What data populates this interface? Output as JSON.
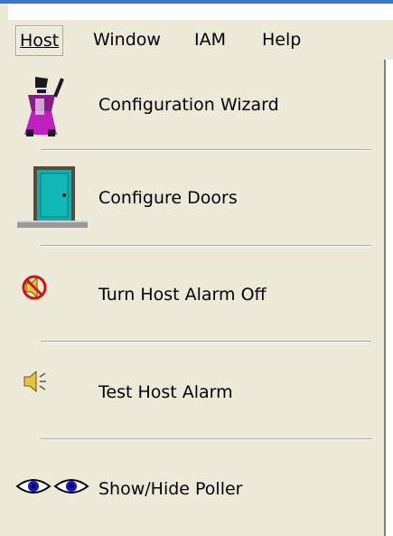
{
  "menubar": {
    "host": "Host",
    "window": "Window",
    "iam": "IAM",
    "help": "Help"
  },
  "dropdown": {
    "items": [
      {
        "label": "Configuration Wizard",
        "icon": "wizard-icon"
      },
      {
        "label": "Configure Doors",
        "icon": "door-icon"
      },
      {
        "label": "Turn Host Alarm Off",
        "icon": "alarm-off-icon"
      },
      {
        "label": "Test Host Alarm",
        "icon": "speaker-icon"
      },
      {
        "label": "Show/Hide Poller",
        "icon": "eyes-icon"
      }
    ]
  }
}
